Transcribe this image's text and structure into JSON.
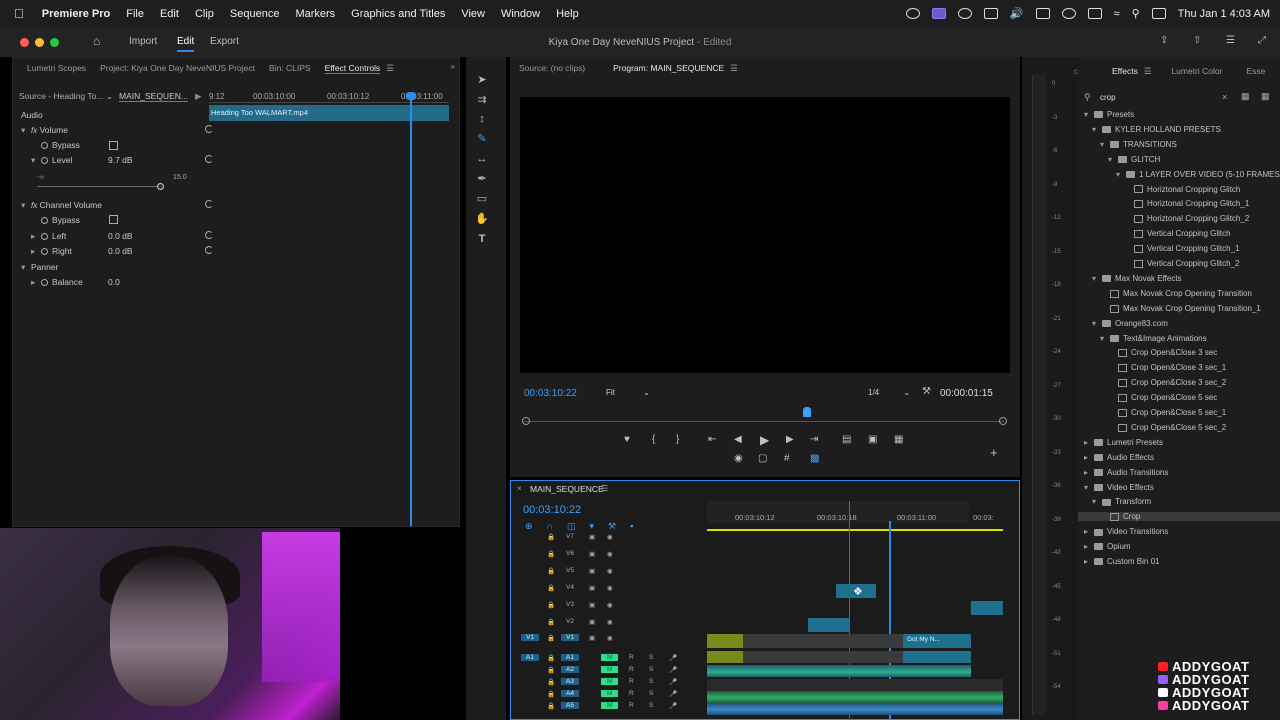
{
  "menubar": {
    "app": "Premiere Pro",
    "items": [
      "File",
      "Edit",
      "Clip",
      "Sequence",
      "Markers",
      "Graphics and Titles",
      "View",
      "Window",
      "Help"
    ],
    "clock": "Thu Jan 1  4:03 AM"
  },
  "header": {
    "nav": [
      "Import",
      "Edit",
      "Export"
    ],
    "active_nav": "Edit",
    "project_title": "Kiya One Day NeveNIUS Project",
    "status": "- Edited"
  },
  "left_panel": {
    "tabs": [
      "Lumetri Scopes",
      "Project: Kiya One Day NeveNIUS Project",
      "Bin: CLIPS",
      "Effect Controls"
    ],
    "active_tab": "Effect Controls",
    "source_label": "Source - Heading To...",
    "sequence_label": "MAIN_SEQUEN...",
    "ruler": [
      "9:12",
      "00:03:10:00",
      "00:03:10:12",
      "00:03:11:00"
    ],
    "clip_name": "Heading Too WALMART.mp4",
    "section": "Audio",
    "volume": "Volume",
    "bypass": "Bypass",
    "level_label": "Level",
    "level_value": "9.7 dB",
    "slider_min": "-∞",
    "slider_max": "15.0",
    "channel_volume": "Channel Volume",
    "left_label": "Left",
    "left_value": "0.0 dB",
    "right_label": "Right",
    "right_value": "0.0 dB",
    "panner": "Panner",
    "balance_label": "Balance",
    "balance_value": "0.0"
  },
  "program": {
    "source_tab": "Source: (no clips)",
    "program_tab": "Program: MAIN_SEQUENCE",
    "timecode": "00:03:10:22",
    "fit": "Fit",
    "resolution": "1/4",
    "duration": "00:00:01:15"
  },
  "timeline": {
    "name": "MAIN_SEQUENCE",
    "timecode": "00:03:10:22",
    "ruler": [
      "00:03:10:12",
      "00:03:10:18",
      "00:03:11:00",
      "00:03:"
    ],
    "video_tracks": [
      "V7",
      "V6",
      "V5",
      "V4",
      "V3",
      "V2",
      "V1"
    ],
    "audio_tracks": [
      "A1",
      "A2",
      "A3",
      "A4",
      "A5"
    ],
    "clip_label": "Got My N...",
    "source_v1": "V1",
    "source_a1": "A1",
    "mute": "M",
    "record": "R",
    "solo": "S"
  },
  "meters": {
    "ticks": [
      "0",
      "-3",
      "-6",
      "-9",
      "-12",
      "-15",
      "-18",
      "-21",
      "-24",
      "-27",
      "-30",
      "-33",
      "-36",
      "-39",
      "-42",
      "-45",
      "-48",
      "-51",
      "-54"
    ]
  },
  "effects": {
    "tabs": [
      "Effects",
      "Lumetri Color",
      "Esse"
    ],
    "search": "crop",
    "tree": [
      {
        "label": "Presets",
        "depth": 0,
        "kind": "folder",
        "open": true
      },
      {
        "label": "KYLER HOLLAND PRESETS",
        "depth": 1,
        "kind": "folder",
        "open": true
      },
      {
        "label": "TRANSITIONS",
        "depth": 2,
        "kind": "folder",
        "open": true
      },
      {
        "label": "GLITCH",
        "depth": 3,
        "kind": "folder",
        "open": true
      },
      {
        "label": "1 LAYER OVER VIDEO (5-10 FRAMES)",
        "depth": 4,
        "kind": "folder",
        "open": true
      },
      {
        "label": "Horiztonal Cropping Glitch",
        "depth": 5,
        "kind": "preset"
      },
      {
        "label": "Horiztonal Cropping Glitch_1",
        "depth": 5,
        "kind": "preset"
      },
      {
        "label": "Horiztonal Cropping Glitch_2",
        "depth": 5,
        "kind": "preset"
      },
      {
        "label": "Vertical Cropping Glitch",
        "depth": 5,
        "kind": "preset"
      },
      {
        "label": "Vertical Cropping Glitch_1",
        "depth": 5,
        "kind": "preset"
      },
      {
        "label": "Vertical Cropping Glitch_2",
        "depth": 5,
        "kind": "preset"
      },
      {
        "label": "Max Novak Effects",
        "depth": 1,
        "kind": "folder",
        "open": true
      },
      {
        "label": "Max Novak Crop Opening Transition",
        "depth": 2,
        "kind": "preset"
      },
      {
        "label": "Max Novak Crop Opening Transition_1",
        "depth": 2,
        "kind": "preset"
      },
      {
        "label": "Orange83.com",
        "depth": 1,
        "kind": "folder",
        "open": true
      },
      {
        "label": "Text&Image Animations",
        "depth": 2,
        "kind": "folder",
        "open": true
      },
      {
        "label": "Crop Open&Close 3 sec",
        "depth": 3,
        "kind": "preset"
      },
      {
        "label": "Crop Open&Close 3 sec_1",
        "depth": 3,
        "kind": "preset"
      },
      {
        "label": "Crop Open&Close 3 sec_2",
        "depth": 3,
        "kind": "preset"
      },
      {
        "label": "Crop Open&Close 5 sec",
        "depth": 3,
        "kind": "preset"
      },
      {
        "label": "Crop Open&Close 5 sec_1",
        "depth": 3,
        "kind": "preset"
      },
      {
        "label": "Crop Open&Close 5 sec_2",
        "depth": 3,
        "kind": "preset"
      },
      {
        "label": "Lumetri Presets",
        "depth": 0,
        "kind": "folder",
        "open": false
      },
      {
        "label": "Audio Effects",
        "depth": 0,
        "kind": "folder",
        "open": false
      },
      {
        "label": "Audio Transitions",
        "depth": 0,
        "kind": "folder",
        "open": false
      },
      {
        "label": "Video Effects",
        "depth": 0,
        "kind": "folder",
        "open": true
      },
      {
        "label": "Transform",
        "depth": 1,
        "kind": "folder",
        "open": true
      },
      {
        "label": "Crop",
        "depth": 2,
        "kind": "effect",
        "selected": true
      },
      {
        "label": "Video Transitions",
        "depth": 0,
        "kind": "folder",
        "open": false
      },
      {
        "label": "Opium",
        "depth": 0,
        "kind": "folder",
        "open": false
      },
      {
        "label": "Custom Bin 01",
        "depth": 0,
        "kind": "folder",
        "open": false
      }
    ]
  },
  "overlay": {
    "brand": [
      "ADDYGOAT",
      "ADDYGOAT",
      "ADDYGOAT",
      "ADDYGOAT"
    ]
  },
  "colors": {
    "accent": "#2d8ceb",
    "timecode": "#3aa0ff",
    "clip_teal": "#1f6f8f",
    "clip_olive": "#7a8a1a",
    "audio_green": "#2fae8a"
  }
}
